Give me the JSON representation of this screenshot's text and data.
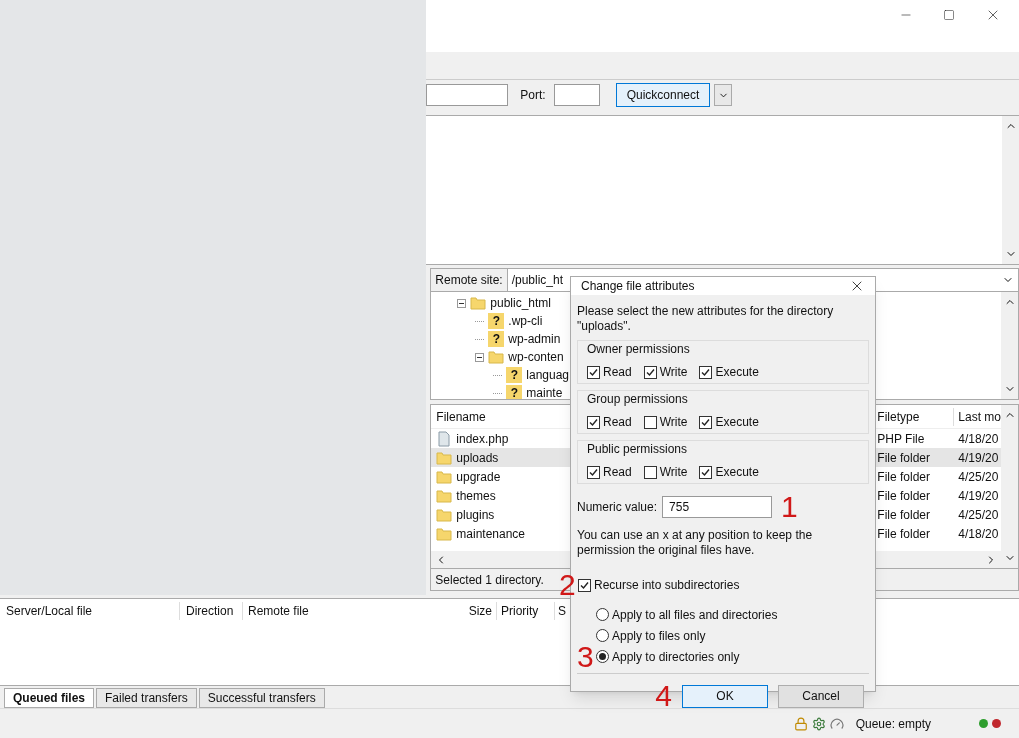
{
  "quickconnect": {
    "port_label": "Port:",
    "button": "Quickconnect"
  },
  "remote": {
    "label": "Remote site:",
    "path": "/public_ht",
    "tree": [
      {
        "name": "public_html",
        "kind": "folder",
        "expanded": true,
        "children": [
          {
            "name": ".wp-cli",
            "kind": "unknown",
            "glyph": "?"
          },
          {
            "name": "wp-admin",
            "kind": "unknown",
            "glyph": "?"
          },
          {
            "name": "wp-conten",
            "kind": "folder",
            "expanded": true,
            "children": [
              {
                "name": "languag",
                "kind": "unknown",
                "glyph": "?"
              },
              {
                "name": "mainte",
                "kind": "unknown",
                "glyph": "?"
              }
            ]
          }
        ]
      }
    ]
  },
  "files": {
    "columns": [
      "Filename",
      "Filetype",
      "Last mo"
    ],
    "rows": [
      {
        "name": "index.php",
        "kind": "file",
        "type": "PHP File",
        "modified": "4/18/20",
        "selected": false
      },
      {
        "name": "uploads",
        "kind": "folder",
        "type": "File folder",
        "modified": "4/19/20",
        "selected": true
      },
      {
        "name": "upgrade",
        "kind": "folder",
        "type": "File folder",
        "modified": "4/25/20",
        "selected": false
      },
      {
        "name": "themes",
        "kind": "folder",
        "type": "File folder",
        "modified": "4/19/20",
        "selected": false
      },
      {
        "name": "plugins",
        "kind": "folder",
        "type": "File folder",
        "modified": "4/25/20",
        "selected": false
      },
      {
        "name": "maintenance",
        "kind": "folder",
        "type": "File folder",
        "modified": "4/18/20",
        "selected": false
      }
    ],
    "status": "Selected 1 directory."
  },
  "queue": {
    "columns": [
      "Server/Local file",
      "Direction",
      "Remote file",
      "Size",
      "Priority",
      "S"
    ],
    "tabs": [
      {
        "label": "Queued files",
        "selected": true
      },
      {
        "label": "Failed transfers",
        "selected": false
      },
      {
        "label": "Successful transfers",
        "selected": false
      }
    ]
  },
  "status_bar": {
    "queue": "Queue: empty",
    "lights": [
      {
        "color": "#2e9e2e"
      },
      {
        "color": "#c0272d"
      }
    ]
  },
  "dialog": {
    "title": "Change file attributes",
    "message": "Please select the new attributes for the directory \"uploads\".",
    "groups": [
      {
        "title": "Owner permissions",
        "options": [
          {
            "label": "Read",
            "checked": true
          },
          {
            "label": "Write",
            "checked": true
          },
          {
            "label": "Execute",
            "checked": true
          }
        ]
      },
      {
        "title": "Group permissions",
        "options": [
          {
            "label": "Read",
            "checked": true
          },
          {
            "label": "Write",
            "checked": false
          },
          {
            "label": "Execute",
            "checked": true
          }
        ]
      },
      {
        "title": "Public permissions",
        "options": [
          {
            "label": "Read",
            "checked": true
          },
          {
            "label": "Write",
            "checked": false
          },
          {
            "label": "Execute",
            "checked": true
          }
        ]
      }
    ],
    "numeric": {
      "label": "Numeric value:",
      "value": "755",
      "annotation": "1"
    },
    "note": "You can use an x at any position to keep the permission the original files have.",
    "recurse": {
      "label": "Recurse into subdirectories",
      "checked": true,
      "annotation": "2"
    },
    "apply": [
      {
        "label": "Apply to all files and directories",
        "selected": false
      },
      {
        "label": "Apply to files only",
        "selected": false
      },
      {
        "label": "Apply to directories only",
        "selected": true,
        "annotation": "3"
      }
    ],
    "buttons_annotation": "4",
    "buttons": [
      {
        "label": "OK",
        "kind": "primary"
      },
      {
        "label": "Cancel",
        "kind": "secondary"
      }
    ]
  }
}
